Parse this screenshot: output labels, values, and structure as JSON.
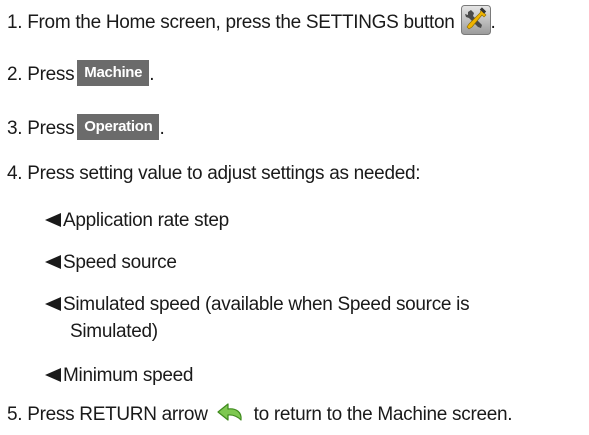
{
  "steps": {
    "s1": {
      "prefix": "1. From the Home screen, press the SETTINGS button",
      "suffix": ".",
      "icon": "settings-icon"
    },
    "s2": {
      "prefix": "2. Press",
      "button": "Machine",
      "suffix": "."
    },
    "s3": {
      "prefix": "3. Press",
      "button": "Operation",
      "suffix": "."
    },
    "s4": {
      "text": "4. Press setting value to adjust settings as needed:"
    },
    "s5": {
      "prefix": "5. Press RETURN arrow",
      "suffix": "to return to the Machine screen.",
      "icon": "return-arrow-icon"
    }
  },
  "settings": [
    "Application rate step",
    "Speed source",
    "Simulated speed (available when Speed source is",
    "Simulated)",
    "Minimum speed"
  ],
  "colors": {
    "button_bg": "#6b6b6b",
    "button_text": "#ffffff",
    "return_arrow": "#7ec850",
    "text": "#1a1a1a"
  }
}
